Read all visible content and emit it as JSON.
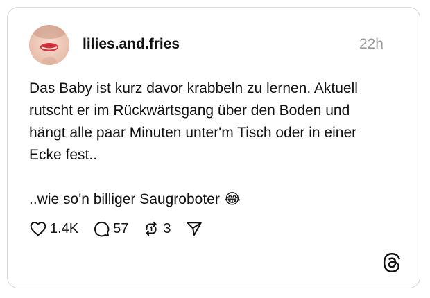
{
  "post": {
    "username": "lilies.and.fries",
    "timestamp": "22h",
    "text_paragraph_1": "Das Baby ist kurz davor krabbeln zu lernen. Aktuell\nrutscht er im Rückwärtsgang über den Boden und\nhängt alle paar Minuten unter'm Tisch oder in einer\nEcke fest..",
    "text_paragraph_2": "..wie so'n billiger Saugroboter 😂"
  },
  "actions": {
    "likes": "1.4K",
    "comments": "57",
    "reposts": "3"
  },
  "icons": {
    "like": "heart-icon",
    "comment": "comment-bubble-icon",
    "repost": "repost-icon",
    "share": "send-icon",
    "brand": "threads-logo-icon"
  },
  "colors": {
    "text": "#111111",
    "muted": "#9a9a9a",
    "border": "#d9d9d9"
  }
}
